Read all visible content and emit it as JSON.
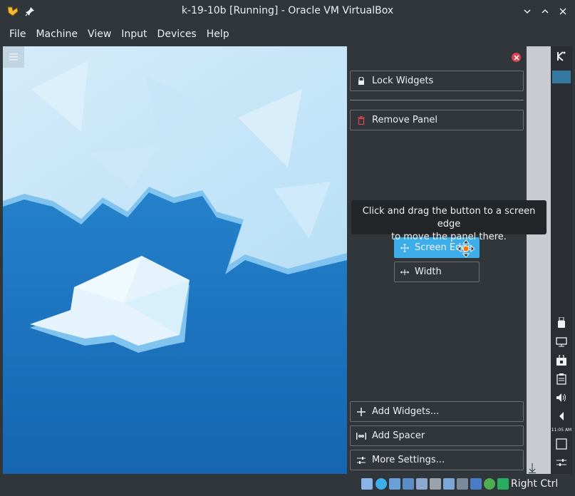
{
  "window": {
    "title": "k-19-10b [Running] - Oracle VM VirtualBox"
  },
  "menubar": {
    "items": [
      "File",
      "Machine",
      "View",
      "Input",
      "Devices",
      "Help"
    ]
  },
  "panel_config": {
    "lock_widgets": "Lock Widgets",
    "remove_panel": "Remove Panel",
    "tooltip_line1": "Click and drag the button to a screen edge",
    "tooltip_line2": "to move the panel there.",
    "screen_edge": "Screen Edge",
    "width": "Width",
    "add_widgets": "Add Widgets...",
    "add_spacer": "Add Spacer",
    "more_settings": "More Settings..."
  },
  "kde_panel": {
    "clock": "11:05 AM"
  },
  "statusbar": {
    "host_key": "Right Ctrl"
  },
  "colors": {
    "background": "#31363b",
    "accent": "#3daee9",
    "close": "#da4453",
    "wallpaper_blue": "#1d78c4"
  },
  "icons": [
    "virtualbox-icon",
    "pin-icon",
    "minimize-icon",
    "maximize-icon",
    "close-icon",
    "hamburger-icon",
    "lock-icon",
    "trash-icon",
    "move-icon",
    "resize-width-icon",
    "plus-icon",
    "spacer-icon",
    "settings-icon",
    "kde-logo-icon"
  ]
}
